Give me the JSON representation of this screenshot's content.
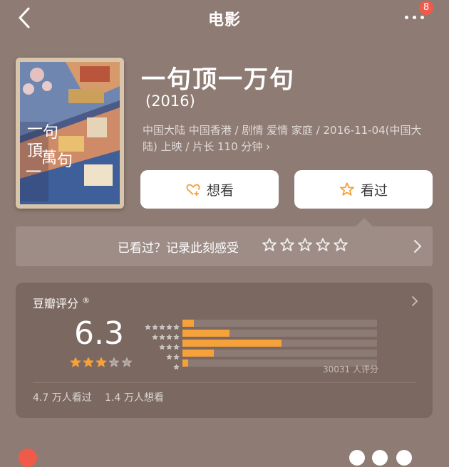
{
  "nav": {
    "title": "电影",
    "badge_count": "8"
  },
  "movie": {
    "title": "一句顶一万句",
    "year": "(2016)",
    "meta": "中国大陆 中国香港 / 剧情 爱情 家庭 / 2016-11-04(中国大陆) 上映 / 片长 110 分钟 ›",
    "poster_text": [
      "一",
      "句",
      "頂",
      "一",
      "萬",
      "句"
    ]
  },
  "actions": {
    "want_label": "想看",
    "seen_label": "看过"
  },
  "record": {
    "text": "已看过？记录此刻感受",
    "star_count": 5
  },
  "rating": {
    "title": "豆瓣评分",
    "reg_mark": "®",
    "score": "6.3",
    "star_level": 3,
    "distribution": [
      {
        "stars": 5,
        "percent": 6
      },
      {
        "stars": 4,
        "percent": 24
      },
      {
        "stars": 3,
        "percent": 51
      },
      {
        "stars": 2,
        "percent": 16
      },
      {
        "stars": 1,
        "percent": 3
      }
    ],
    "votes": "30031 人评分",
    "seen_count": "4.7 万人看过",
    "want_count": "1.4 万人想看"
  },
  "colors": {
    "background": "#8e7b73",
    "accent": "#f6a13a",
    "badge": "#ef5a4b"
  }
}
